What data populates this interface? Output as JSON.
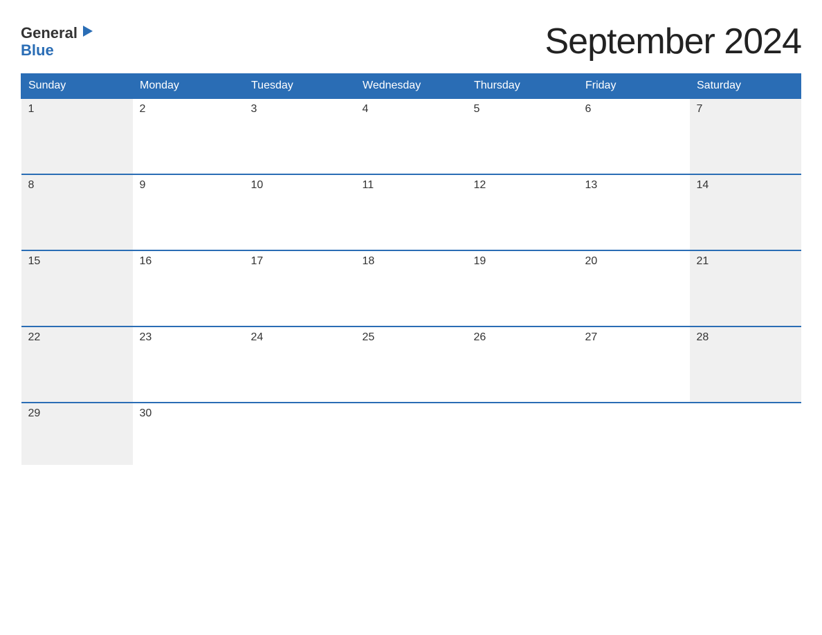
{
  "header": {
    "logo": {
      "general": "General",
      "blue": "Blue",
      "arrow_color": "#2a6db5"
    },
    "title": "September 2024"
  },
  "calendar": {
    "days_of_week": [
      "Sunday",
      "Monday",
      "Tuesday",
      "Wednesday",
      "Thursday",
      "Friday",
      "Saturday"
    ],
    "weeks": [
      [
        {
          "day": 1,
          "type": "sunday"
        },
        {
          "day": 2,
          "type": "weekday"
        },
        {
          "day": 3,
          "type": "weekday"
        },
        {
          "day": 4,
          "type": "weekday"
        },
        {
          "day": 5,
          "type": "weekday"
        },
        {
          "day": 6,
          "type": "weekday"
        },
        {
          "day": 7,
          "type": "saturday"
        }
      ],
      [
        {
          "day": 8,
          "type": "sunday"
        },
        {
          "day": 9,
          "type": "weekday"
        },
        {
          "day": 10,
          "type": "weekday"
        },
        {
          "day": 11,
          "type": "weekday"
        },
        {
          "day": 12,
          "type": "weekday"
        },
        {
          "day": 13,
          "type": "weekday"
        },
        {
          "day": 14,
          "type": "saturday"
        }
      ],
      [
        {
          "day": 15,
          "type": "sunday"
        },
        {
          "day": 16,
          "type": "weekday"
        },
        {
          "day": 17,
          "type": "weekday"
        },
        {
          "day": 18,
          "type": "weekday"
        },
        {
          "day": 19,
          "type": "weekday"
        },
        {
          "day": 20,
          "type": "weekday"
        },
        {
          "day": 21,
          "type": "saturday"
        }
      ],
      [
        {
          "day": 22,
          "type": "sunday"
        },
        {
          "day": 23,
          "type": "weekday"
        },
        {
          "day": 24,
          "type": "weekday"
        },
        {
          "day": 25,
          "type": "weekday"
        },
        {
          "day": 26,
          "type": "weekday"
        },
        {
          "day": 27,
          "type": "weekday"
        },
        {
          "day": 28,
          "type": "saturday"
        }
      ],
      [
        {
          "day": 29,
          "type": "sunday"
        },
        {
          "day": 30,
          "type": "weekday"
        },
        {
          "day": null,
          "type": "empty"
        },
        {
          "day": null,
          "type": "empty"
        },
        {
          "day": null,
          "type": "empty"
        },
        {
          "day": null,
          "type": "empty"
        },
        {
          "day": null,
          "type": "empty"
        }
      ]
    ]
  }
}
